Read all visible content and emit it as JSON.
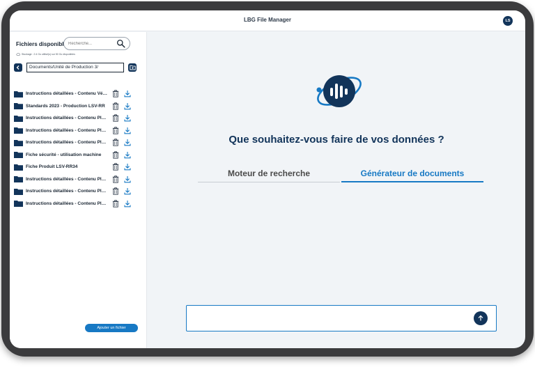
{
  "app": {
    "title": "LBG File Manager",
    "user_initials": "LS"
  },
  "sidebar": {
    "title": "Fichiers disponibles",
    "search_placeholder": "Recherche...",
    "storage_text": "Stockage : 2.4 Go utilisé(s) sur 50 Go disponibles",
    "current_path": "Documents/Unité de Production 3/",
    "files": [
      {
        "name": "Instructions détaillées - Contenu Véhicule"
      },
      {
        "name": "Standards 2023 - Production LSV-RR"
      },
      {
        "name": "Instructions détaillées - Contenu Plateforme"
      },
      {
        "name": "Instructions détaillées - Contenu Plateforme"
      },
      {
        "name": "Instructions détaillées - Contenu Plateforme"
      },
      {
        "name": "Fiche sécurité - utilisation machine"
      },
      {
        "name": "Fiche Produit LSV-RR34"
      },
      {
        "name": "Instructions détaillées - Contenu Plateforme"
      },
      {
        "name": "Instructions détaillées - Contenu Plateforme"
      },
      {
        "name": "Instructions détaillées - Contenu Plateforme"
      }
    ],
    "add_button_label": "Ajouter un fichier"
  },
  "main": {
    "question": "Que souhaitez-vous faire de vos données ?",
    "tabs": [
      {
        "label": "Moteur de recherche",
        "active": false
      },
      {
        "label": "Générateur de documents",
        "active": true
      }
    ],
    "chat_placeholder": ""
  },
  "colors": {
    "brand_dark": "#12345a",
    "accent_blue": "#1779c4",
    "device_frame": "#3b3b3d"
  }
}
